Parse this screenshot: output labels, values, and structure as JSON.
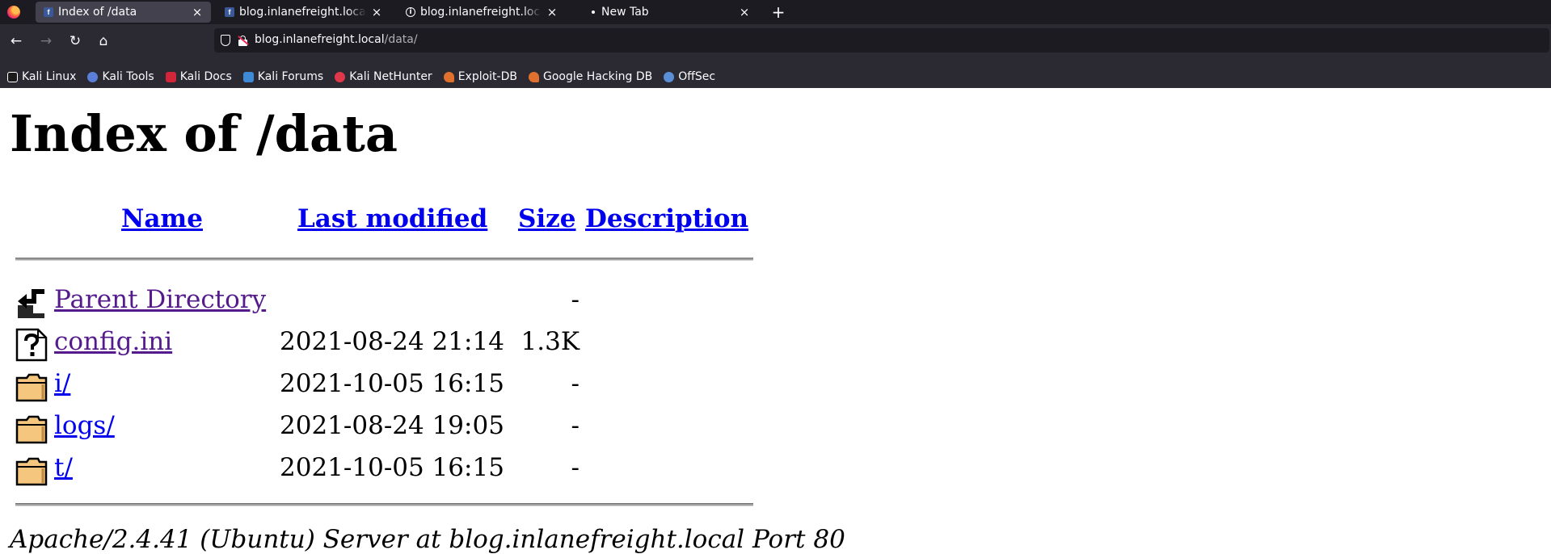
{
  "browser": {
    "tabs": [
      {
        "title": "Index of /data",
        "icon": "facebook-icon",
        "active": true
      },
      {
        "title": "blog.inlanefreight.local/data/",
        "icon": "facebook-icon",
        "active": false
      },
      {
        "title": "blog.inlanefreight.local/api",
        "icon": "info-icon",
        "active": false
      },
      {
        "title": "New Tab",
        "icon": "dot-icon",
        "active": false
      }
    ],
    "url_host": "blog.inlanefreight.local",
    "url_path": "/data/",
    "bookmarks": [
      {
        "label": "Kali Linux",
        "color": "#ffffff"
      },
      {
        "label": "Kali Tools",
        "color": "#5b7fd8"
      },
      {
        "label": "Kali Docs",
        "color": "#d1253a"
      },
      {
        "label": "Kali Forums",
        "color": "#3f8ad6"
      },
      {
        "label": "Kali NetHunter",
        "color": "#e0384b"
      },
      {
        "label": "Exploit-DB",
        "color": "#e0702d"
      },
      {
        "label": "Google Hacking DB",
        "color": "#e0702d"
      },
      {
        "label": "OffSec",
        "color": "#5a8fd8"
      }
    ]
  },
  "page": {
    "title": "Index of /data",
    "headers": {
      "name": "Name",
      "last_modified": "Last modified",
      "size": "Size",
      "description": "Description"
    },
    "rows": [
      {
        "name": "Parent Directory",
        "date": "",
        "size": "-",
        "icon": "parent-directory-icon"
      },
      {
        "name": "config.ini",
        "date": "2021-08-24 21:14",
        "size": "1.3K",
        "icon": "unknown-file-icon"
      },
      {
        "name": "i/",
        "date": "2021-10-05 16:15",
        "size": "-",
        "icon": "folder-icon"
      },
      {
        "name": "logs/",
        "date": "2021-08-24 19:05",
        "size": "-",
        "icon": "folder-icon"
      },
      {
        "name": "t/",
        "date": "2021-10-05 16:15",
        "size": "-",
        "icon": "folder-icon"
      }
    ],
    "footer": "Apache/2.4.41 (Ubuntu) Server at blog.inlanefreight.local Port 80"
  }
}
